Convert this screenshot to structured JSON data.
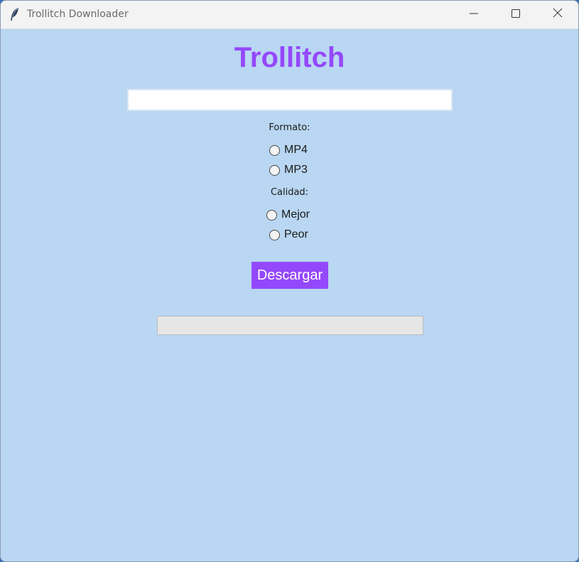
{
  "window": {
    "title": "Trollitch Downloader",
    "icon": "feather-icon",
    "controls": [
      "minimize-icon",
      "maximize-icon",
      "close-icon"
    ]
  },
  "app": {
    "heading": "Trollitch",
    "accent_color": "#9448fb",
    "background_color": "#b9d6f2"
  },
  "url_input": {
    "value": "",
    "placeholder": ""
  },
  "format": {
    "label": "Formato:",
    "options": [
      "MP4",
      "MP3"
    ],
    "selected": null
  },
  "quality": {
    "label": "Calidad:",
    "options": [
      "Mejor",
      "Peor"
    ],
    "selected": null
  },
  "download_button": {
    "label": "Descargar"
  },
  "progress": {
    "value": 0
  }
}
